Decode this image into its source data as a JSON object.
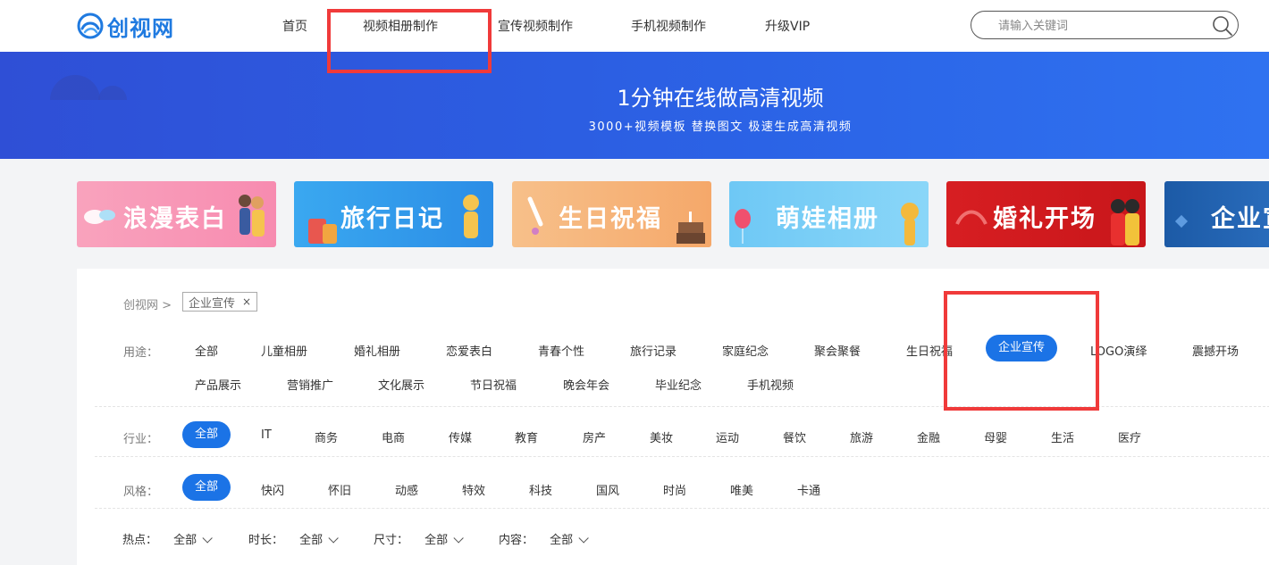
{
  "header": {
    "logo_text": "创视网",
    "nav": [
      "首页",
      "视频相册制作",
      "宣传视频制作",
      "手机视频制作",
      "升级VIP"
    ],
    "search_placeholder": "请输入关键词"
  },
  "banner": {
    "title": "1分钟在线做高清视频",
    "subtitle": "3000+视频模板 替换图文 极速生成高清视频"
  },
  "cards": [
    "浪漫表白",
    "旅行日记",
    "生日祝福",
    "萌娃相册",
    "婚礼开场",
    "企业宣"
  ],
  "breadcrumb": {
    "root": "创视网 >",
    "tag": "企业宣传",
    "close": "×"
  },
  "filters": {
    "usage_label": "用途：",
    "usage": [
      "全部",
      "儿童相册",
      "婚礼相册",
      "恋爱表白",
      "青春个性",
      "旅行记录",
      "家庭纪念",
      "聚会聚餐",
      "生日祝福",
      "企业宣传",
      "LOGO演绎",
      "震撼开场",
      "产品展示",
      "营销推广",
      "文化展示",
      "节日祝福",
      "晚会年会",
      "毕业纪念",
      "手机视频"
    ],
    "usage_active": "企业宣传",
    "industry_label": "行业：",
    "industry": [
      "全部",
      "IT",
      "商务",
      "电商",
      "传媒",
      "教育",
      "房产",
      "美妆",
      "运动",
      "餐饮",
      "旅游",
      "金融",
      "母婴",
      "生活",
      "医疗"
    ],
    "industry_active": "全部",
    "style_label": "风格：",
    "style": [
      "全部",
      "快闪",
      "怀旧",
      "动感",
      "特效",
      "科技",
      "国风",
      "时尚",
      "唯美",
      "卡通"
    ],
    "style_active": "全部",
    "dropdowns": [
      {
        "label": "热点：",
        "value": "全部"
      },
      {
        "label": "时长：",
        "value": "全部"
      },
      {
        "label": "尺寸：",
        "value": "全部"
      },
      {
        "label": "内容：",
        "value": "全部"
      }
    ]
  },
  "colors": {
    "brand": "#1f7ae0",
    "active": "#1b73e6",
    "annotation": "#f03a3a"
  }
}
